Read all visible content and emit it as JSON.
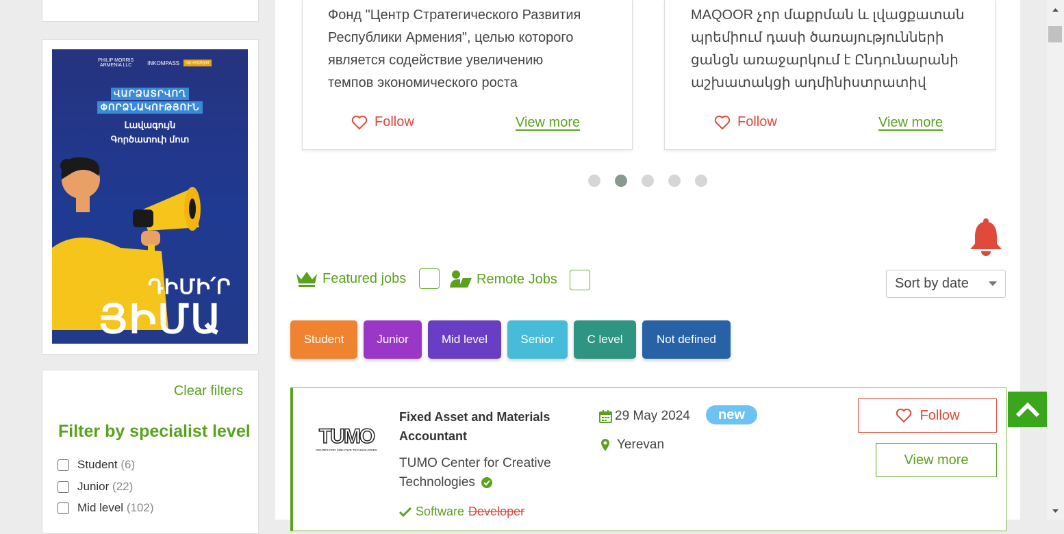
{
  "top_cards": [
    {
      "text_lines": [
        "Фонд \"Центр Стратегического Развития",
        "Республики Армения\", целью которого",
        "является содействие увеличению",
        "темпов экономического роста"
      ],
      "follow_label": "Follow",
      "view_more_label": "View more"
    },
    {
      "text_lines": [
        "MAQOOR չոր մաքրման և լվացքատան",
        "պրեմիում դասի ծառայությունների",
        "ցանցն առաջարկում է Ընդունարանի",
        "աշխատակցի ադմինիստրատիվ"
      ],
      "follow_label": "Follow",
      "view_more_label": "View more"
    }
  ],
  "carousel": {
    "count": 5,
    "active_index": 1
  },
  "ad_banner": {
    "logos": [
      "PHILIP MORRIS ARMENIA LLC",
      "INKOMPASS",
      "top employer"
    ],
    "headline_lines": [
      "ՎԱՐՁԱՏՐՎՈՂ",
      "ՓՈՐՁՆԱԿՈՒԹՅՈՒՆ"
    ],
    "subline_lines": [
      "Լավագույն",
      "Գործատուի մոտ"
    ],
    "cta_top": "ԴԻՄԻ՛Ր",
    "cta_bottom": "ՅԻՄԱ"
  },
  "filters": {
    "clear_label": "Clear filters",
    "title": "Filter by specialist level",
    "items": [
      {
        "label": "Student",
        "count": "(6)"
      },
      {
        "label": "Junior",
        "count": "(22)"
      },
      {
        "label": "Mid level",
        "count": "(102)"
      }
    ]
  },
  "toggles": {
    "featured_label": "Featured jobs",
    "remote_label": "Remote Jobs"
  },
  "sort": {
    "selected": "Sort by date"
  },
  "levels": [
    {
      "label": "Student",
      "color": "#f0832f"
    },
    {
      "label": "Junior",
      "color": "#9a37c7"
    },
    {
      "label": "Mid level",
      "color": "#6a3ec4"
    },
    {
      "label": "Senior",
      "color": "#47bcd9"
    },
    {
      "label": "C level",
      "color": "#2e9582"
    },
    {
      "label": "Not defined",
      "color": "#2862a6"
    }
  ],
  "job": {
    "logo_text": "TUMO",
    "logo_sub": "CENTER FOR CREATIVE TECHNOLOGIES",
    "title_lines": [
      "Fixed Asset and Materials",
      "Accountant"
    ],
    "company_lines": [
      "TUMO Center for Creative",
      "Technologies"
    ],
    "date": "29 May 2024",
    "badge": "new",
    "location": "Yerevan",
    "tag_match": "Software",
    "tag_miss": "Developer",
    "follow_label": "Follow",
    "view_more_label": "View more"
  },
  "colors": {
    "accent_green": "#5aa21e",
    "follow_red": "#e0493a",
    "bell_red": "#e04a3b",
    "badge_blue": "#6cc2f5"
  }
}
